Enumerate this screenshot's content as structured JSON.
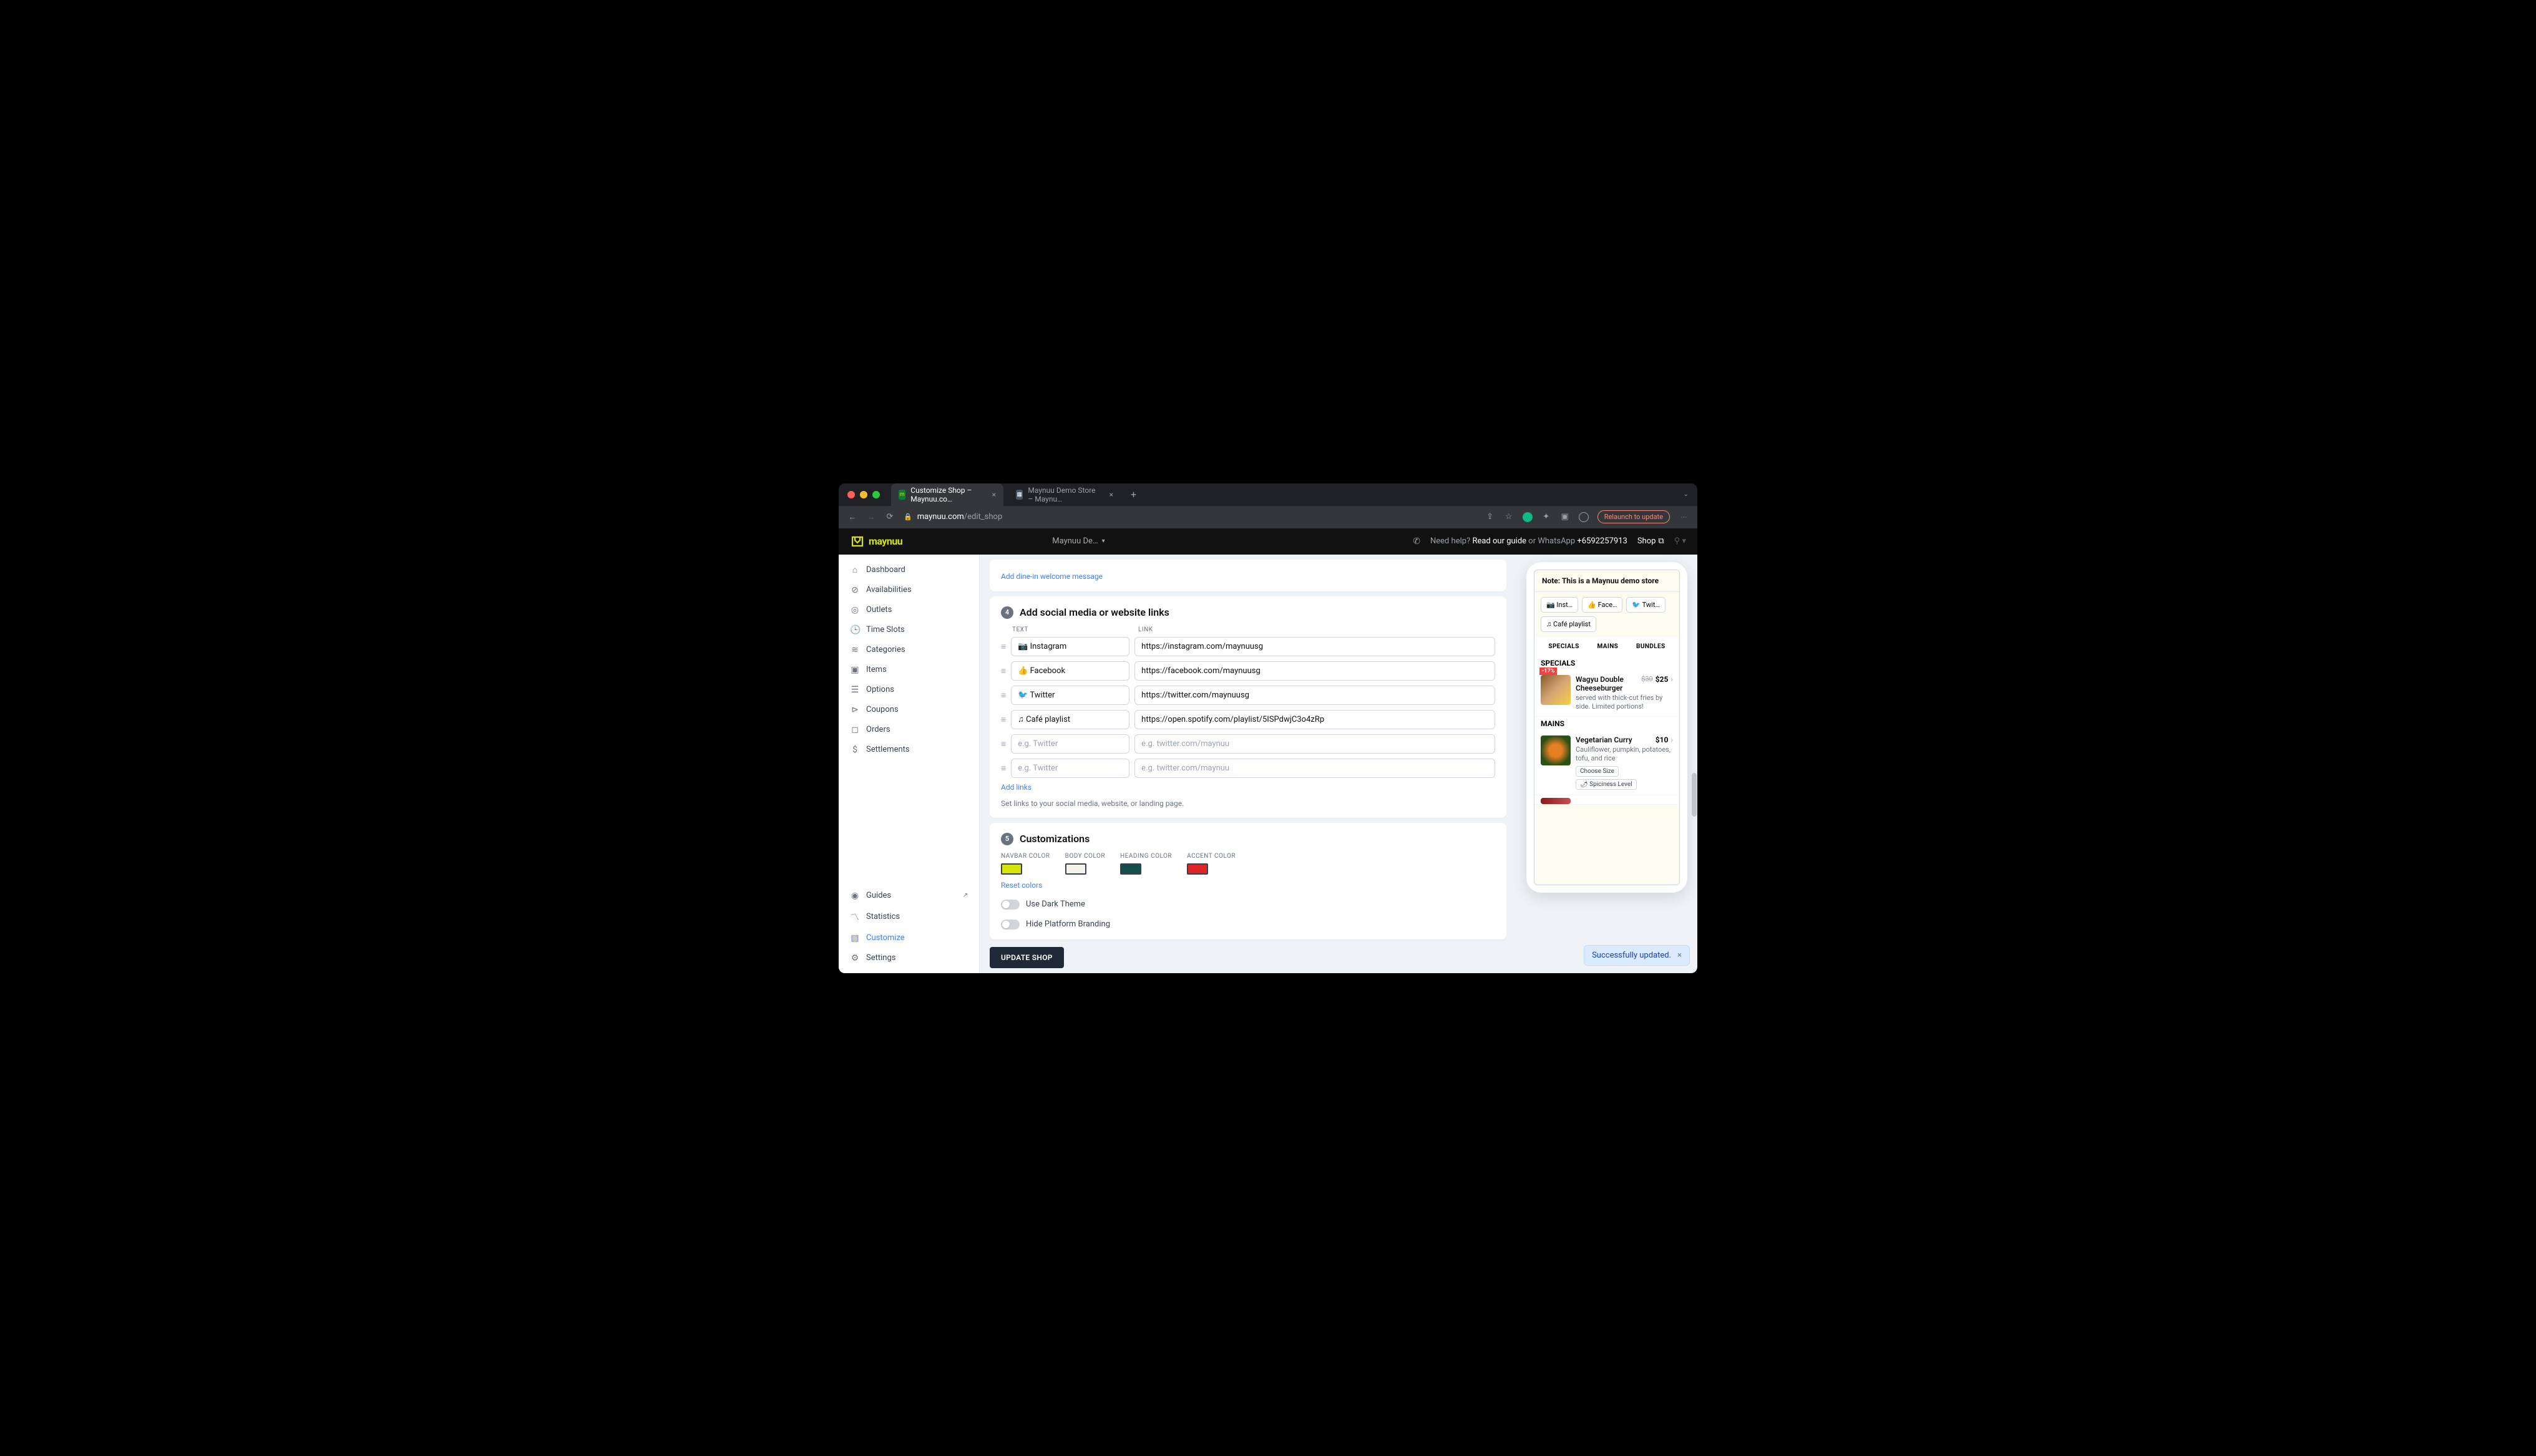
{
  "browser": {
    "tabs": [
      {
        "title": "Customize Shop – Maynuu.co…"
      },
      {
        "title": "Maynuu Demo Store – Maynu…"
      }
    ],
    "url_domain": "maynuu.com",
    "url_path": "/edit_shop",
    "relaunch": "Relaunch to update"
  },
  "header": {
    "brand": "maynuu",
    "store": "Maynuu De…",
    "need_help": "Need help?",
    "guide": "Read our guide",
    "or": "or WhatsApp",
    "phone": "+6592257913",
    "shop": "Shop"
  },
  "sidebar": {
    "items": [
      "Dashboard",
      "Availabilities",
      "Outlets",
      "Time Slots",
      "Categories",
      "Items",
      "Options",
      "Coupons",
      "Orders",
      "Settlements"
    ],
    "bottom": [
      "Guides",
      "Statistics",
      "Customize",
      "Settings"
    ]
  },
  "top_card": {
    "link": "Add dine-in welcome message"
  },
  "links_section": {
    "num": "4",
    "title": "Add social media or website links",
    "col_text": "TEXT",
    "col_link": "LINK",
    "rows": [
      {
        "text": "📷 Instagram",
        "link": "https://instagram.com/maynuusg"
      },
      {
        "text": "👍 Facebook",
        "link": "https://facebook.com/maynuusg"
      },
      {
        "text": "🐦 Twitter",
        "link": "https://twitter.com/maynuusg"
      },
      {
        "text": "♫ Café playlist",
        "link": "https://open.spotify.com/playlist/5ISPdwjC3o4zRp"
      }
    ],
    "placeholder_text": "e.g. Twitter",
    "placeholder_link": "e.g. twitter.com/maynuu",
    "add": "Add links",
    "helper": "Set links to your social media, website, or landing page."
  },
  "custom_section": {
    "num": "5",
    "title": "Customizations",
    "colors": [
      {
        "label": "NAVBAR COLOR",
        "hex": "#d4e50a"
      },
      {
        "label": "BODY COLOR",
        "hex": "#f5f3e7"
      },
      {
        "label": "HEADING COLOR",
        "hex": "#134e4a"
      },
      {
        "label": "ACCENT COLOR",
        "hex": "#dc2626"
      }
    ],
    "reset": "Reset colors",
    "dark": "Use Dark Theme",
    "branding": "Hide Platform Branding"
  },
  "update_btn": "UPDATE SHOP",
  "preview": {
    "note": "Note: This is a Maynuu demo store",
    "chips": [
      "📷 Inst…",
      "👍 Face…",
      "🐦 Twit…",
      "♫ Café playlist"
    ],
    "cats": [
      "SPECIALS",
      "MAINS",
      "BUNDLES"
    ],
    "specials_head": "SPECIALS",
    "mains_head": "MAINS",
    "item1": {
      "discount": "-17%",
      "name": "Wagyu Double Cheeseburger",
      "old": "$30",
      "new": "$25",
      "desc": "served with thick-cut fries by side. Limited portions!"
    },
    "item2": {
      "name": "Vegetarian Curry",
      "price": "$10",
      "desc": "Cauliflower, pumpkin, potatoes, tofu, and rice",
      "opt1": "Choose Size",
      "opt2": "🌶 Spiciness Level"
    }
  },
  "toast": "Successfully updated."
}
